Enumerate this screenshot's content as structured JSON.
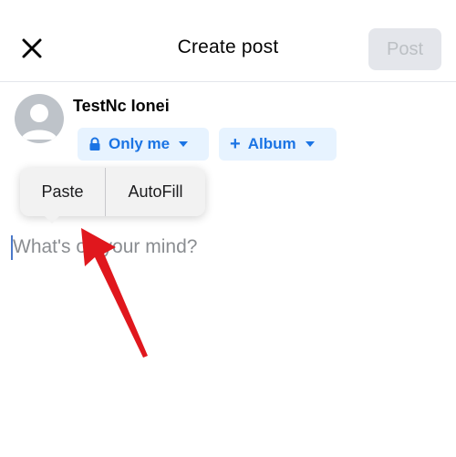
{
  "header": {
    "title": "Create post",
    "post_label": "Post",
    "close_icon": "close-icon"
  },
  "user": {
    "name": "TestNc Ionei",
    "avatar_icon": "default-avatar-icon"
  },
  "audience": {
    "label": "Only me",
    "icon": "lock-icon"
  },
  "album": {
    "prefix": "+",
    "label": "Album"
  },
  "context_menu": {
    "paste_label": "Paste",
    "autofill_label": "AutoFill"
  },
  "composer": {
    "placeholder": "What's on your mind?"
  },
  "annotation": {
    "arrow_color": "#e0171d"
  },
  "colors": {
    "accent": "#1b74e4",
    "pill_bg": "#e7f3ff",
    "disabled_bg": "#e4e6eb"
  }
}
